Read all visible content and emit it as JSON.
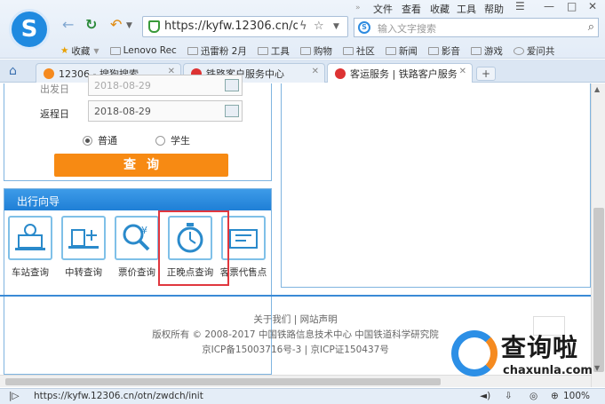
{
  "browser": {
    "url": "https://kyfw.12306.cn/otn",
    "menu": [
      "文件",
      "查看",
      "收藏",
      "工具",
      "帮助"
    ],
    "search_placeholder": "输入文字搜索",
    "bookmarks": [
      "收藏",
      "Lenovo Rec",
      "迅雷粉 2月",
      "工具",
      "购物",
      "社区",
      "新闻",
      "影音",
      "游戏",
      "爱问共"
    ],
    "tabs": [
      {
        "label": "12306 - 搜狗搜索",
        "active": false
      },
      {
        "label": "铁路客户服务中心",
        "active": false
      },
      {
        "label": "客运服务 | 铁路客户服务",
        "active": true
      }
    ],
    "status_url": "https://kyfw.12306.cn/otn/zwdch/init",
    "zoom": "100%"
  },
  "form": {
    "depart_label": "出发日",
    "depart_value": "2018-08-29",
    "return_label": "返程日",
    "return_value": "2018-08-29",
    "radio_normal": "普通",
    "radio_student": "学生",
    "query_button": "查询"
  },
  "guide": {
    "title": "出行向导",
    "items": [
      {
        "label": "车站查询",
        "icon": "station-icon"
      },
      {
        "label": "中转查询",
        "icon": "transfer-icon"
      },
      {
        "label": "票价查询",
        "icon": "price-search-icon"
      },
      {
        "label": "正晚点查询",
        "icon": "stopwatch-icon"
      },
      {
        "label": "客票代售点",
        "icon": "ticket-agent-icon"
      }
    ]
  },
  "footer": {
    "links": [
      "关于我们",
      "网站声明"
    ],
    "copyright": "版权所有 © 2008-2017 中国铁路信息技术中心 中国铁道科学研究院",
    "icp": "京ICP备15003716号-3 | 京ICP证150437号"
  },
  "watermark": {
    "text": "查询啦",
    "domain": "chaxunla.com"
  }
}
